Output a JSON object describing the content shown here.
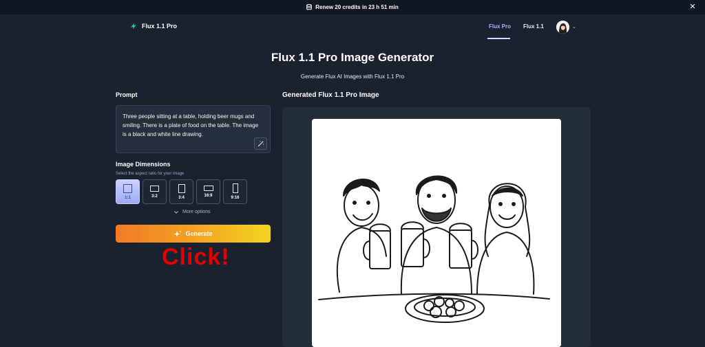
{
  "banner": {
    "text": "Renew 20 credits in 23 h 51 min",
    "close": "✕"
  },
  "nav": {
    "logo": "Flux 1.1 Pro",
    "links": [
      "Flux Pro",
      "Flux 1.1"
    ],
    "active_link": "Flux Pro",
    "avatar_chevron": "⌄"
  },
  "header": {
    "title": "Flux 1.1 Pro Image Generator",
    "subtitle": "Generate Flux AI Images with Flux 1.1 Pro"
  },
  "form": {
    "prompt_label": "Prompt",
    "prompt_value": "Three people sitting at a table, holding beer mugs and smiling. There is a plate of food on the table. The image is a black and white line drawing.",
    "dimensions_label": "Image Dimensions",
    "dimensions_hint": "Select the aspect ratio for your image",
    "ratios": [
      "1:1",
      "3:2",
      "3:4",
      "16:9",
      "9:16"
    ],
    "selected_ratio": "1:1",
    "more_options": "More options",
    "generate_label": "Generate"
  },
  "annotation": {
    "text": "Click!",
    "color": "#e50000"
  },
  "result": {
    "label": "Generated Flux 1.1 Pro Image",
    "image_icon": "generated-line-drawing-image"
  },
  "colors": {
    "background": "#1a2230",
    "accent": "#9fb8ff",
    "generate_gradient": [
      "#f07a27",
      "#f2d320"
    ]
  }
}
